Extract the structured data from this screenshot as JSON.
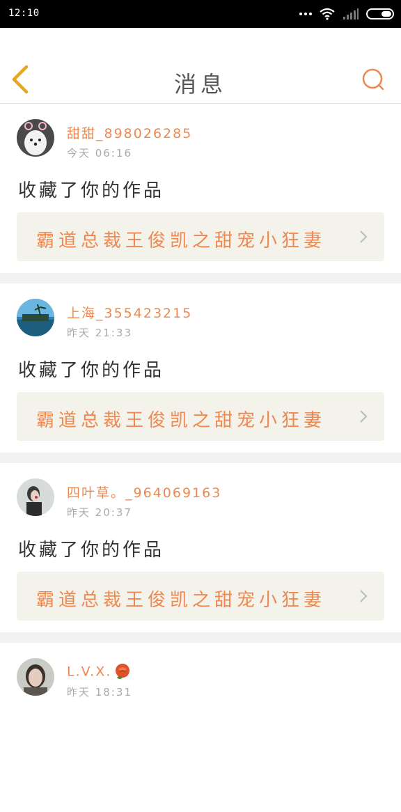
{
  "status_bar": {
    "time": "12:10"
  },
  "header": {
    "title": "消息"
  },
  "messages": [
    {
      "username": "甜甜_898026285",
      "time": "今天 06:16",
      "action": "收藏了你的作品",
      "work_title": "霸道总裁王俊凯之甜宠小狂妻"
    },
    {
      "username": "上海_355423215",
      "time": "昨天 21:33",
      "action": "收藏了你的作品",
      "work_title": "霸道总裁王俊凯之甜宠小狂妻"
    },
    {
      "username": "四叶草。_964069163",
      "time": "昨天 20:37",
      "action": "收藏了你的作品",
      "work_title": "霸道总裁王俊凯之甜宠小狂妻"
    },
    {
      "username": "L.V.X.",
      "time": "昨天 18:31"
    }
  ],
  "colors": {
    "accent": "#ee8850",
    "work_bg": "#f3f3ec",
    "back_arrow": "#e8a623"
  }
}
